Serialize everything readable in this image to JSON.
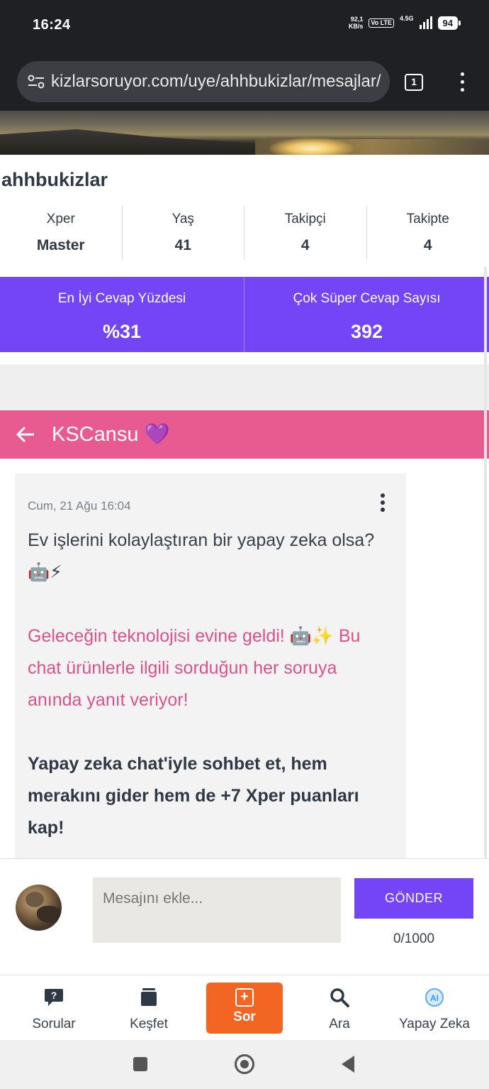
{
  "status_bar": {
    "time": "16:24",
    "net_speed_value": "92,1",
    "net_speed_unit": "KB/s",
    "volte_label": "Vo LTE",
    "network_type": "4.5G",
    "battery": "94"
  },
  "browser": {
    "url": "kizlarsoruyor.com/uye/ahhbukizlar/mesajlar/",
    "tab_count": "1"
  },
  "profile": {
    "username": "ahhbukizlar",
    "stats": [
      {
        "label": "Xper",
        "value": "Master"
      },
      {
        "label": "Yaş",
        "value": "41"
      },
      {
        "label": "Takipçi",
        "value": "4"
      },
      {
        "label": "Takipte",
        "value": "4"
      }
    ],
    "highlights": [
      {
        "label": "En İyi Cevap Yüzdesi",
        "value": "%31"
      },
      {
        "label": "Çok Süper Cevap Sayısı",
        "value": "392"
      }
    ]
  },
  "chat": {
    "title": "KSCansu 💜",
    "message": {
      "timestamp": "Cum, 21 Ağu 16:04",
      "line1": "Ev işlerini kolaylaştıran bir yapay zeka olsa? 🤖⚡",
      "line2": "Geleceğin teknolojisi evine geldi! 🤖✨ Bu chat ürünlerle ilgili sorduğun her soruya anında yanıt veriyor!",
      "line3": "Yapay zeka chat'iyle sohbet et, hem merakını gider hem de +7 Xper puanları kap!"
    }
  },
  "composer": {
    "placeholder": "Mesajını ekle...",
    "send_label": "GÖNDER",
    "counter": "0/1000"
  },
  "bottom_nav": {
    "items": [
      {
        "label": "Sorular",
        "icon": "question-bubble-icon"
      },
      {
        "label": "Keşfet",
        "icon": "stack-icon"
      },
      {
        "label": "Sor",
        "icon": "plus-square-icon"
      },
      {
        "label": "Ara",
        "icon": "search-icon"
      },
      {
        "label": "Yapay Zeka",
        "icon": "ai-icon"
      }
    ],
    "ai_icon_text": "AI"
  },
  "colors": {
    "purple": "#7444f7",
    "pink": "#e85b91",
    "orange": "#f26522"
  }
}
